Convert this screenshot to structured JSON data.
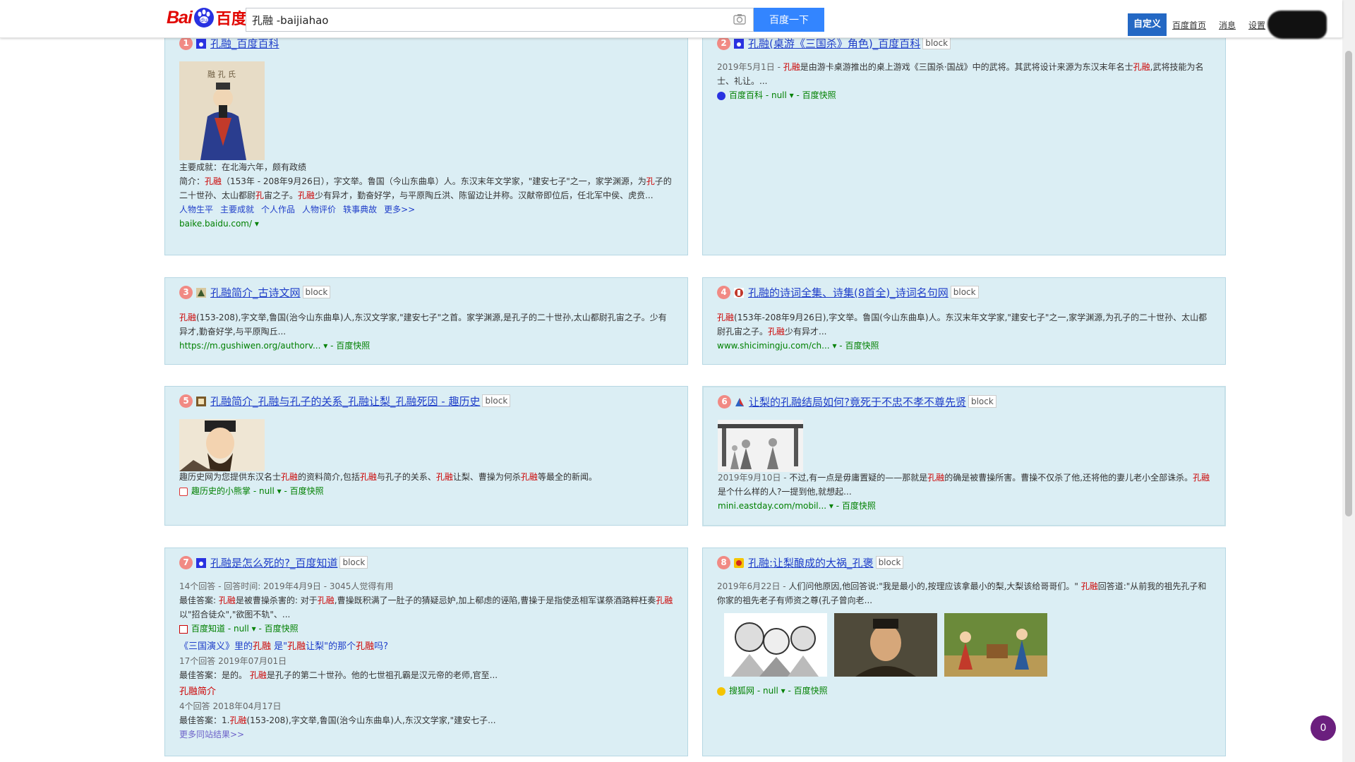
{
  "header": {
    "logo_left": "Bai",
    "logo_right": "百度",
    "search_value": "孔融 -baijiahao",
    "search_button": "百度一下",
    "nav_customize": "自定义",
    "nav_home": "百度首页",
    "nav_messages": "消息",
    "nav_settings": "设置"
  },
  "colors": {
    "accent": "#3385ff",
    "card_bg": "#dbeef4",
    "title": "#1f3ec9",
    "url": "#008000",
    "highlight": "#c00"
  },
  "results": {
    "r1": {
      "num": "1",
      "title": "孔融_百度百科",
      "achievement": "主要成就：在北海六年，颇有政绩",
      "links": [
        "人物生平",
        "主要成就",
        "个人作品",
        "人物评价",
        "轶事典故",
        "更多>>"
      ],
      "url": "baike.baidu.com/"
    },
    "r2": {
      "num": "2",
      "title": "孔融(桌游《三国杀》角色)_百度百科",
      "block": "block",
      "date": "2019年5月1日 - ",
      "source": "百度百科 - null",
      "snapshot": "- 百度快照"
    },
    "r3": {
      "num": "3",
      "title": "孔融简介_古诗文网",
      "block": "block",
      "url": "https://m.gushiwen.org/authorv...",
      "snapshot": "- 百度快照"
    },
    "r4": {
      "num": "4",
      "title": "孔融的诗词全集、诗集(8首全)_诗词名句网",
      "block": "block",
      "url": "www.shicimingju.com/ch...",
      "snapshot": "- 百度快照"
    },
    "r5": {
      "num": "5",
      "title": "孔融简介_孔融与孔子的关系_孔融让梨_孔融死因 - 趣历史",
      "block": "block",
      "source": "趣历史的小熊掌 - null",
      "snapshot": "- 百度快照"
    },
    "r6": {
      "num": "6",
      "title": "让梨的孔融结局如何?竟死于不忠不孝不尊先贤",
      "block": "block",
      "date": "2019年9月10日 - ",
      "url": "mini.eastday.com/mobil...",
      "snapshot": "- 百度快照"
    },
    "r7": {
      "num": "7",
      "title": "孔融是怎么死的?_百度知道",
      "block": "block",
      "meta": "14个回答 - 回答时间: 2019年4月9日 - 3045人觉得有用",
      "source": "百度知道 - null",
      "snapshot": "- 百度快照",
      "sub2_meta": "17个回答   2019年07月01日",
      "sub3_title": "孔融简介",
      "sub3_meta": "4个回答   2018年04月17日",
      "more": "更多同站结果>>"
    },
    "r8": {
      "num": "8",
      "title": "孔融:让梨酿成的大祸_孔褒",
      "block": "block",
      "date": "2019年6月22日 - ",
      "source": "搜狐网 - null",
      "snapshot": "- 百度快照"
    }
  },
  "badge_count": "0"
}
